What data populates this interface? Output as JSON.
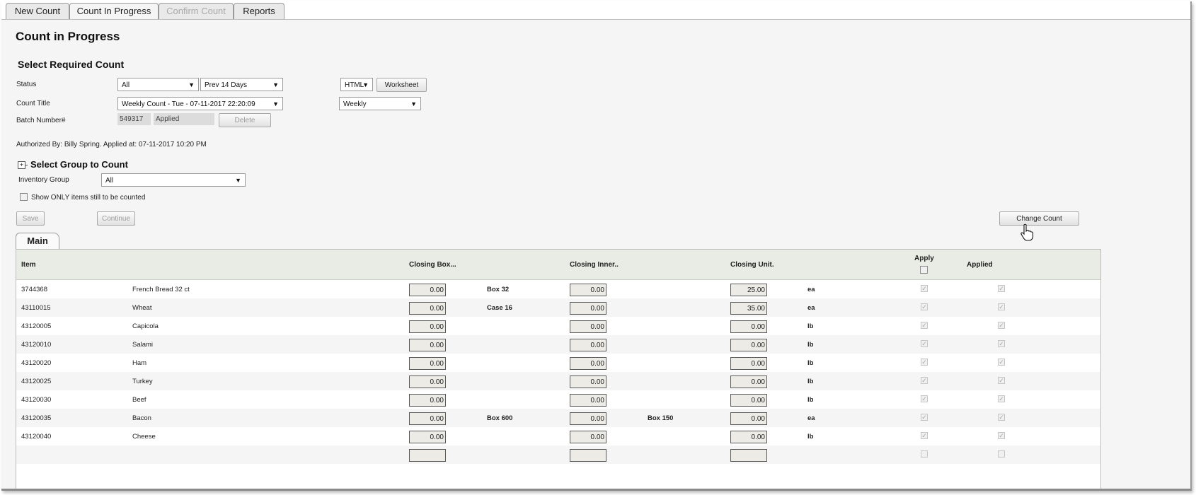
{
  "tabs": [
    {
      "label": "New Count"
    },
    {
      "label": "Count In Progress"
    },
    {
      "label": "Confirm Count"
    },
    {
      "label": "Reports"
    }
  ],
  "page_title": "Count in Progress",
  "section_title": "Select Required Count",
  "status": {
    "label": "Status",
    "value": "All",
    "range": "Prev 14 Days"
  },
  "format": {
    "value": "HTML",
    "worksheet_label": "Worksheet"
  },
  "count_title": {
    "label": "Count Title",
    "value": "Weekly Count - Tue - 07-11-2017 22:20:09",
    "frequency": "Weekly"
  },
  "batch": {
    "label": "Batch Number#",
    "number": "549317",
    "state": "Applied",
    "delete_label": "Delete"
  },
  "authorized": "Authorized By: Billy Spring. Applied at: 07-11-2017 10:20 PM",
  "group_section": {
    "toggle": "+",
    "title": "Select Group to Count"
  },
  "inventory_group": {
    "label": "Inventory Group",
    "value": "All"
  },
  "show_only": {
    "label": "Show ONLY items still to be counted",
    "checked": false
  },
  "buttons": {
    "save": "Save",
    "continue": "Continue",
    "change_count": "Change Count"
  },
  "grid_tab": "Main",
  "columns": {
    "item": "Item",
    "closing_box": "Closing Box...",
    "closing_inner": "Closing Inner..",
    "closing_unit": "Closing Unit.",
    "apply": "Apply",
    "applied": "Applied"
  },
  "rows": [
    {
      "code": "3744368",
      "name": "French Bread 32 ct",
      "box": "0.00",
      "box_pack": "Box 32",
      "inner": "0.00",
      "inner_pack": "",
      "unit": "25.00",
      "uom": "ea"
    },
    {
      "code": "43110015",
      "name": "Wheat",
      "box": "0.00",
      "box_pack": "Case 16",
      "inner": "0.00",
      "inner_pack": "",
      "unit": "35.00",
      "uom": "ea"
    },
    {
      "code": "43120005",
      "name": "Capicola",
      "box": "0.00",
      "box_pack": "",
      "inner": "0.00",
      "inner_pack": "",
      "unit": "0.00",
      "uom": "lb"
    },
    {
      "code": "43120010",
      "name": "Salami",
      "box": "0.00",
      "box_pack": "",
      "inner": "0.00",
      "inner_pack": "",
      "unit": "0.00",
      "uom": "lb"
    },
    {
      "code": "43120020",
      "name": "Ham",
      "box": "0.00",
      "box_pack": "",
      "inner": "0.00",
      "inner_pack": "",
      "unit": "0.00",
      "uom": "lb"
    },
    {
      "code": "43120025",
      "name": "Turkey",
      "box": "0.00",
      "box_pack": "",
      "inner": "0.00",
      "inner_pack": "",
      "unit": "0.00",
      "uom": "lb"
    },
    {
      "code": "43120030",
      "name": "Beef",
      "box": "0.00",
      "box_pack": "",
      "inner": "0.00",
      "inner_pack": "",
      "unit": "0.00",
      "uom": "lb"
    },
    {
      "code": "43120035",
      "name": "Bacon",
      "box": "0.00",
      "box_pack": "Box 600",
      "inner": "0.00",
      "inner_pack": "Box 150",
      "unit": "0.00",
      "uom": "ea"
    },
    {
      "code": "43120040",
      "name": "Cheese",
      "box": "0.00",
      "box_pack": "",
      "inner": "0.00",
      "inner_pack": "",
      "unit": "0.00",
      "uom": "lb"
    }
  ]
}
